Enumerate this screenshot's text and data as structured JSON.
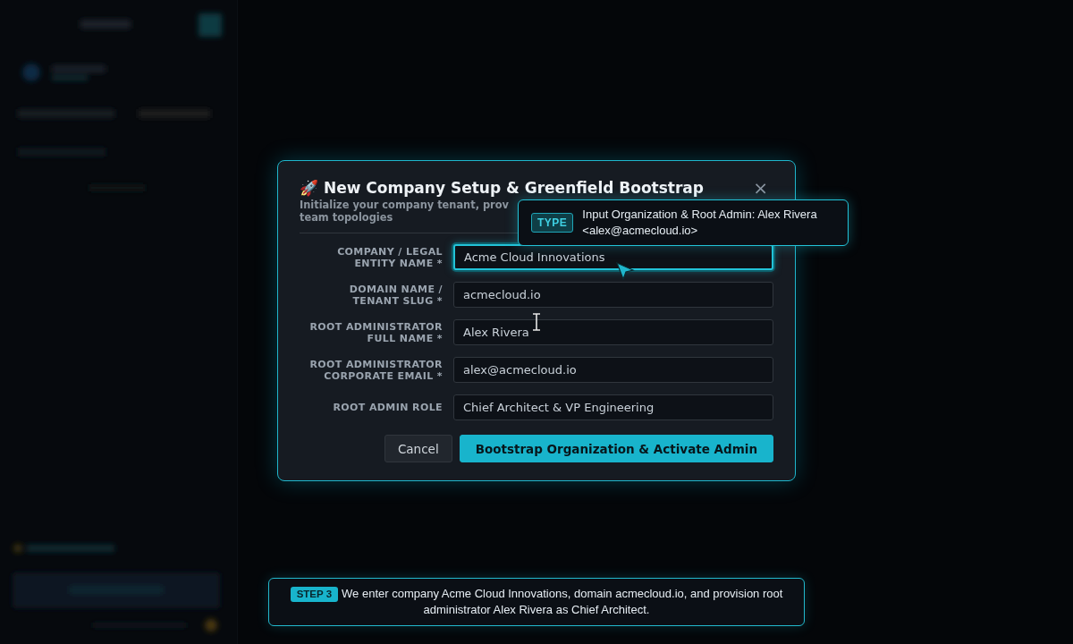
{
  "dialog": {
    "icon": "🚀",
    "title": "New Company Setup & Greenfield Bootstrap",
    "close": "×",
    "subtitle_lines": [
      "Initialize your company tenant, prov",
      "team topologies"
    ],
    "fields": [
      {
        "label": "COMPANY / LEGAL ENTITY NAME *",
        "value": "Acme Cloud Innovations",
        "focused": true
      },
      {
        "label": "DOMAIN NAME / TENANT SLUG *",
        "value": "acmecloud.io",
        "focused": false
      },
      {
        "label": "ROOT ADMINISTRATOR FULL NAME *",
        "value": "Alex Rivera",
        "focused": false
      },
      {
        "label": "ROOT ADMINISTRATOR CORPORATE EMAIL *",
        "value": "alex@acmecloud.io",
        "focused": false
      },
      {
        "label": "ROOT ADMIN ROLE",
        "value": "Chief Architect & VP Engineering",
        "focused": false
      }
    ],
    "buttons": [
      {
        "label": "Cancel",
        "kind": "secondary"
      },
      {
        "label": "Bootstrap Organization & Activate Admin",
        "kind": "primary"
      }
    ]
  },
  "tooltip": {
    "badge": "TYPE",
    "text": "Input Organization & Root Admin: Alex Rivera <alex@acmecloud.io>"
  },
  "step_banner": {
    "badge": "STEP 3",
    "text": "We enter company Acme Cloud Innovations, domain acmecloud.io, and provision root administrator Alex Rivera as Chief Architect."
  }
}
